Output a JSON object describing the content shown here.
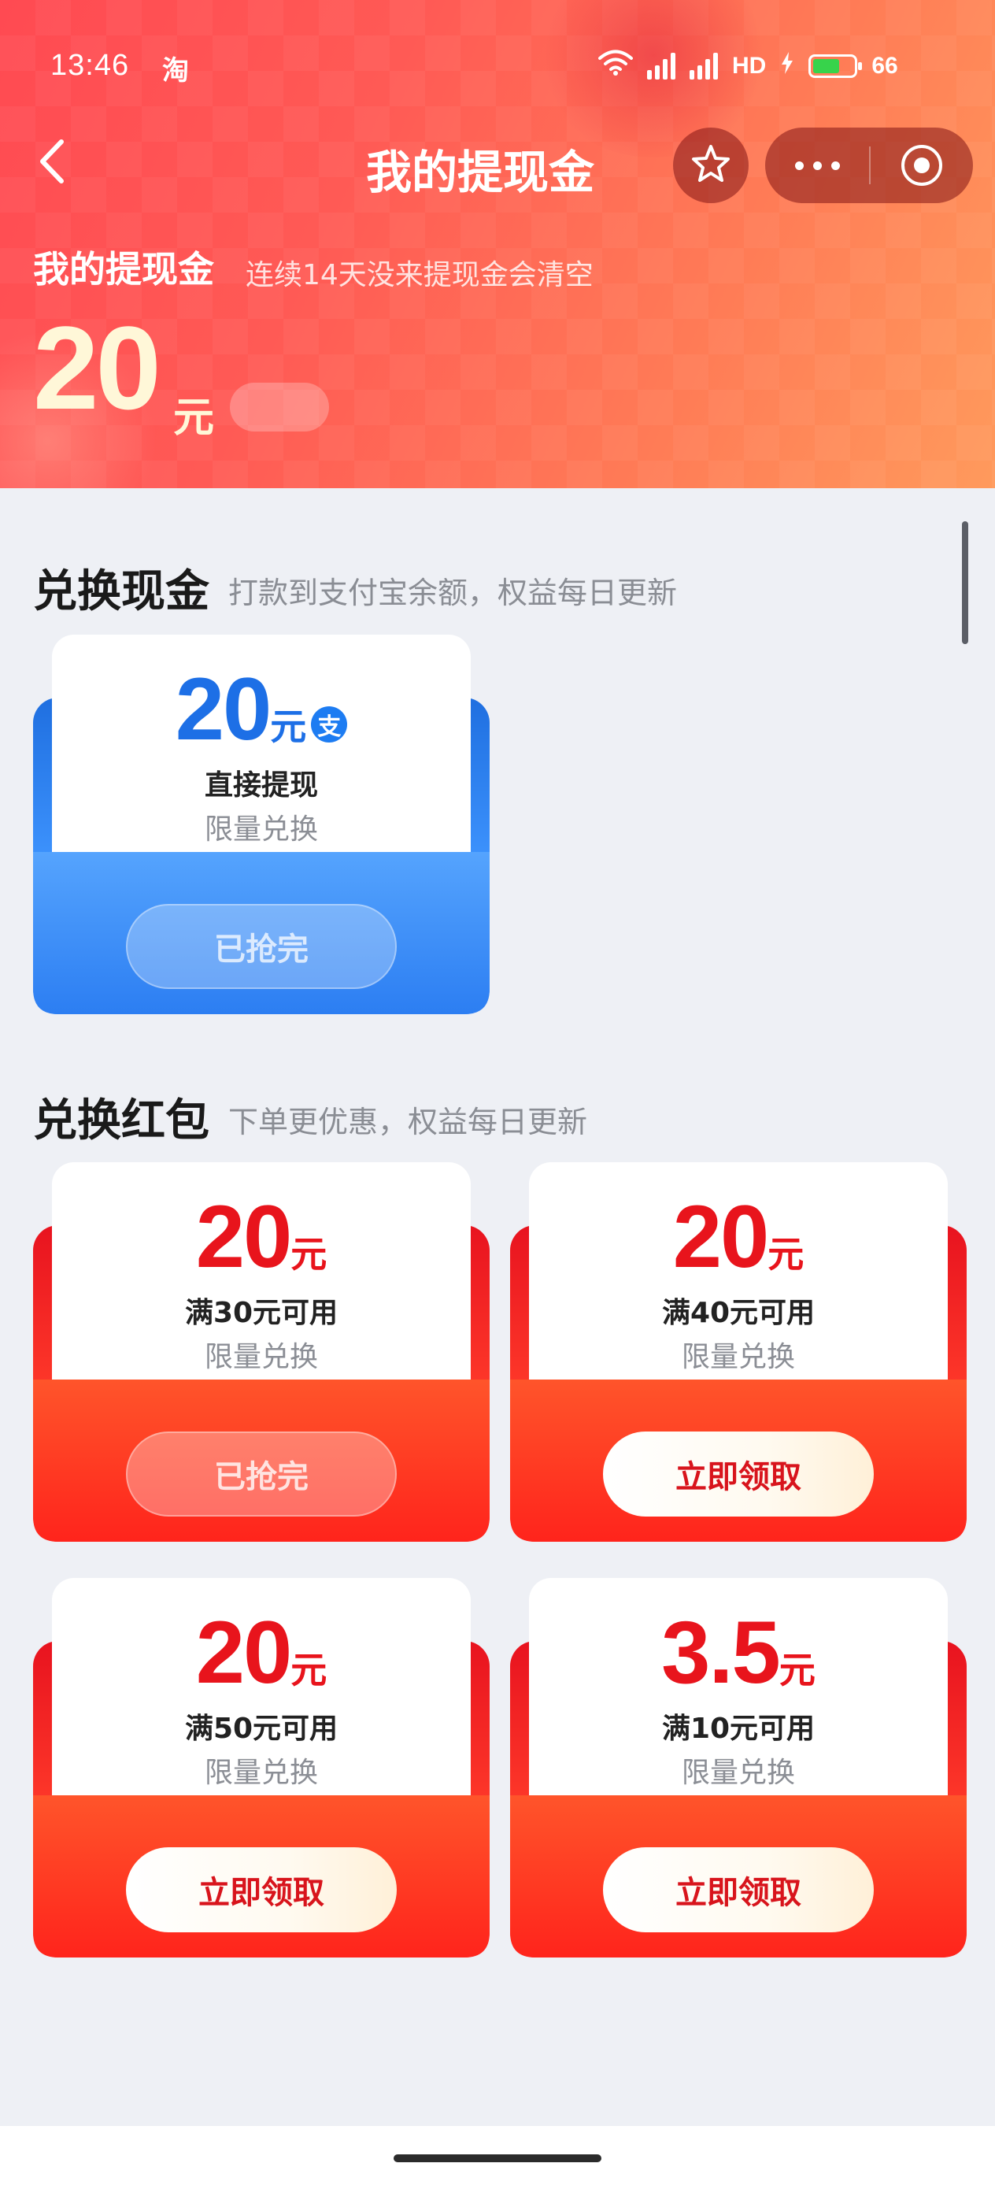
{
  "status_bar": {
    "time": "13:46",
    "app_indicator": "淘",
    "network": "HD",
    "battery": "66",
    "battery_level": 0.66
  },
  "nav": {
    "title": "我的提现金"
  },
  "wallet": {
    "title": "我的提现金",
    "notice": "连续14天没来提现金会清空",
    "amount": "20",
    "unit": "元"
  },
  "cash_section": {
    "title": "兑换现金",
    "subtitle": "打款到支付宝余额，权益每日更新",
    "cards": [
      {
        "value": "20",
        "unit": "元",
        "badge": "支",
        "condition": "直接提现",
        "limit": "限量兑换",
        "button": "已抢完",
        "available": false
      }
    ]
  },
  "redpacket_section": {
    "title": "兑换红包",
    "subtitle": "下单更优惠，权益每日更新",
    "cards": [
      {
        "value": "20",
        "unit": "元",
        "condition": "满30元可用",
        "limit": "限量兑换",
        "button": "已抢完",
        "available": false
      },
      {
        "value": "20",
        "unit": "元",
        "condition": "满40元可用",
        "limit": "限量兑换",
        "button": "立即领取",
        "available": true
      },
      {
        "value": "20",
        "unit": "元",
        "condition": "满50元可用",
        "limit": "限量兑换",
        "button": "立即领取",
        "available": true
      },
      {
        "value": "3.5",
        "unit": "元",
        "condition": "满10元可用",
        "limit": "限量兑换",
        "button": "立即领取",
        "available": true
      }
    ]
  },
  "colors": {
    "header_start": "#ff4a52",
    "header_end": "#ff9a5c",
    "red_accent": "#e8141c",
    "blue_accent": "#1d6fe6",
    "background": "#eef0f5"
  },
  "icons": [
    "back-arrow-icon",
    "star-icon",
    "more-dots-icon",
    "target-icon",
    "wifi-icon",
    "signal-icon",
    "charging-icon",
    "battery-icon",
    "alipay-icon"
  ]
}
